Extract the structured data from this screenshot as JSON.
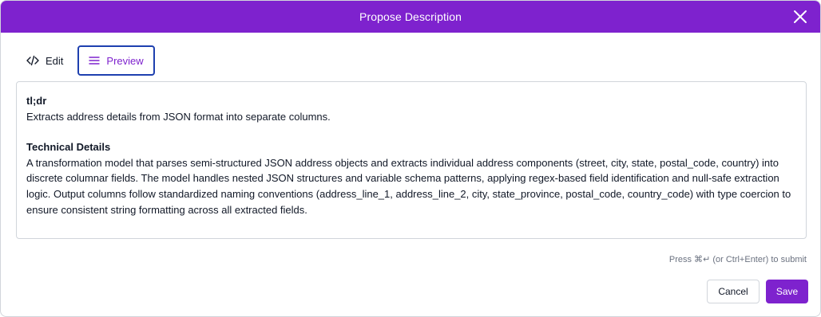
{
  "dialog": {
    "title": "Propose Description",
    "accent_color": "#7e22ce"
  },
  "tabs": [
    {
      "label": "Edit",
      "icon": "code-icon",
      "active": false
    },
    {
      "label": "Preview",
      "icon": "lines-icon",
      "active": true
    }
  ],
  "preview": {
    "tldr_heading": "tl;dr",
    "tldr_text": "Extracts address details from JSON format into separate columns.",
    "details_heading": "Technical Details",
    "details_text": "A transformation model that parses semi-structured JSON address objects and extracts individual address components (street, city, state, postal_code, country) into discrete columnar fields. The model handles nested JSON structures and variable schema patterns, applying regex-based field identification and null-safe extraction logic. Output columns follow standardized naming conventions (address_line_1, address_line_2, city, state_province, postal_code, country_code) with type coercion to ensure consistent string formatting across all extracted fields."
  },
  "footer": {
    "hint": "Press ⌘↵ (or Ctrl+Enter) to submit",
    "cancel_label": "Cancel",
    "save_label": "Save"
  }
}
